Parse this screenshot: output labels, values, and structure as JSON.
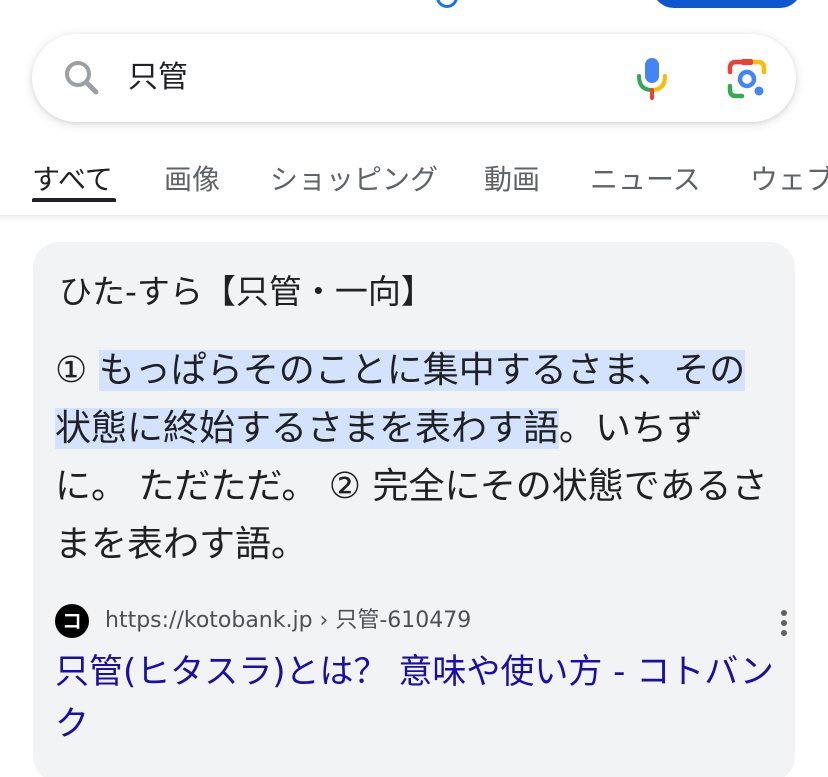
{
  "search": {
    "query": "只管"
  },
  "tabs": [
    {
      "label": "すべて",
      "active": true
    },
    {
      "label": "画像"
    },
    {
      "label": "ショッピング"
    },
    {
      "label": "動画"
    },
    {
      "label": "ニュース"
    },
    {
      "label": "ウェブ"
    }
  ],
  "card": {
    "title": "ひた-すら【只管・一向】",
    "definition": {
      "marker1": "① ",
      "highlighted": "もっぱらそのことに集中するさま、その状態に終始するさまを表わす語",
      "rest": "。いちずに。 ただただ。 ② 完全にその状態であるさまを表わす語。"
    },
    "source": {
      "favicon_letter": "コ",
      "url": "https://kotobank.jp › 只管-610479"
    },
    "link_title": "只管(ヒタスラ)とは？ 意味や使い方 - コトバンク"
  },
  "colors": {
    "link": "#1a0dab",
    "highlight": "#d3e3fd",
    "card_bg": "#f1f3f4"
  }
}
